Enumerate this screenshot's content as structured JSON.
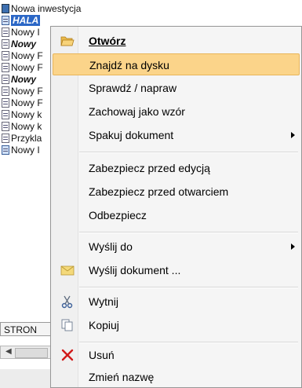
{
  "tree": {
    "items": [
      {
        "label": "Nowa inwestycja",
        "icon": "database-icon",
        "style": "normal"
      },
      {
        "label": "HALA",
        "icon": "document-icon",
        "style": "selected"
      },
      {
        "label": "Nowy I",
        "icon": "document-icon",
        "style": "normal"
      },
      {
        "label": "Nowy",
        "icon": "document-icon",
        "style": "bold"
      },
      {
        "label": "Nowy F",
        "icon": "document-icon",
        "style": "normal"
      },
      {
        "label": "Nowy F",
        "icon": "document-icon",
        "style": "normal"
      },
      {
        "label": "Nowy",
        "icon": "document-icon",
        "style": "bold"
      },
      {
        "label": "Nowy F",
        "icon": "document-icon",
        "style": "normal"
      },
      {
        "label": "Nowy F",
        "icon": "document-icon",
        "style": "normal"
      },
      {
        "label": "Nowy k",
        "icon": "document-icon",
        "style": "normal"
      },
      {
        "label": "Nowy k",
        "icon": "document-icon",
        "style": "normal"
      },
      {
        "label": "Przykla",
        "icon": "document-icon",
        "style": "normal"
      },
      {
        "label": "Nowy I",
        "icon": "blue-document-icon",
        "style": "normal"
      }
    ]
  },
  "status_tab": {
    "label": "STRON"
  },
  "menu": {
    "items": {
      "otworz": "Otwórz",
      "znajdz": "Znajdź na dysku",
      "sprawdz": "Sprawdź / napraw",
      "zachowaj": "Zachowaj jako wzór",
      "spakuj": "Spakuj dokument",
      "zabezpiecz_edycja": "Zabezpiecz przed edycją",
      "zabezpiecz_otwarcie": "Zabezpiecz przed otwarciem",
      "odbezpiecz": "Odbezpiecz",
      "wyslij_do": "Wyślij do",
      "wyslij_dokument": "Wyślij dokument ...",
      "wytnij": "Wytnij",
      "kopiuj": "Kopiuj",
      "usun": "Usuń",
      "zmien_nazwe": "Zmień nazwę"
    },
    "highlighted": "Znajdź na dysku",
    "colors": {
      "highlight": "#fbd48a",
      "highlight_border": "#e8b55a",
      "selection": "#2b67c6"
    }
  }
}
